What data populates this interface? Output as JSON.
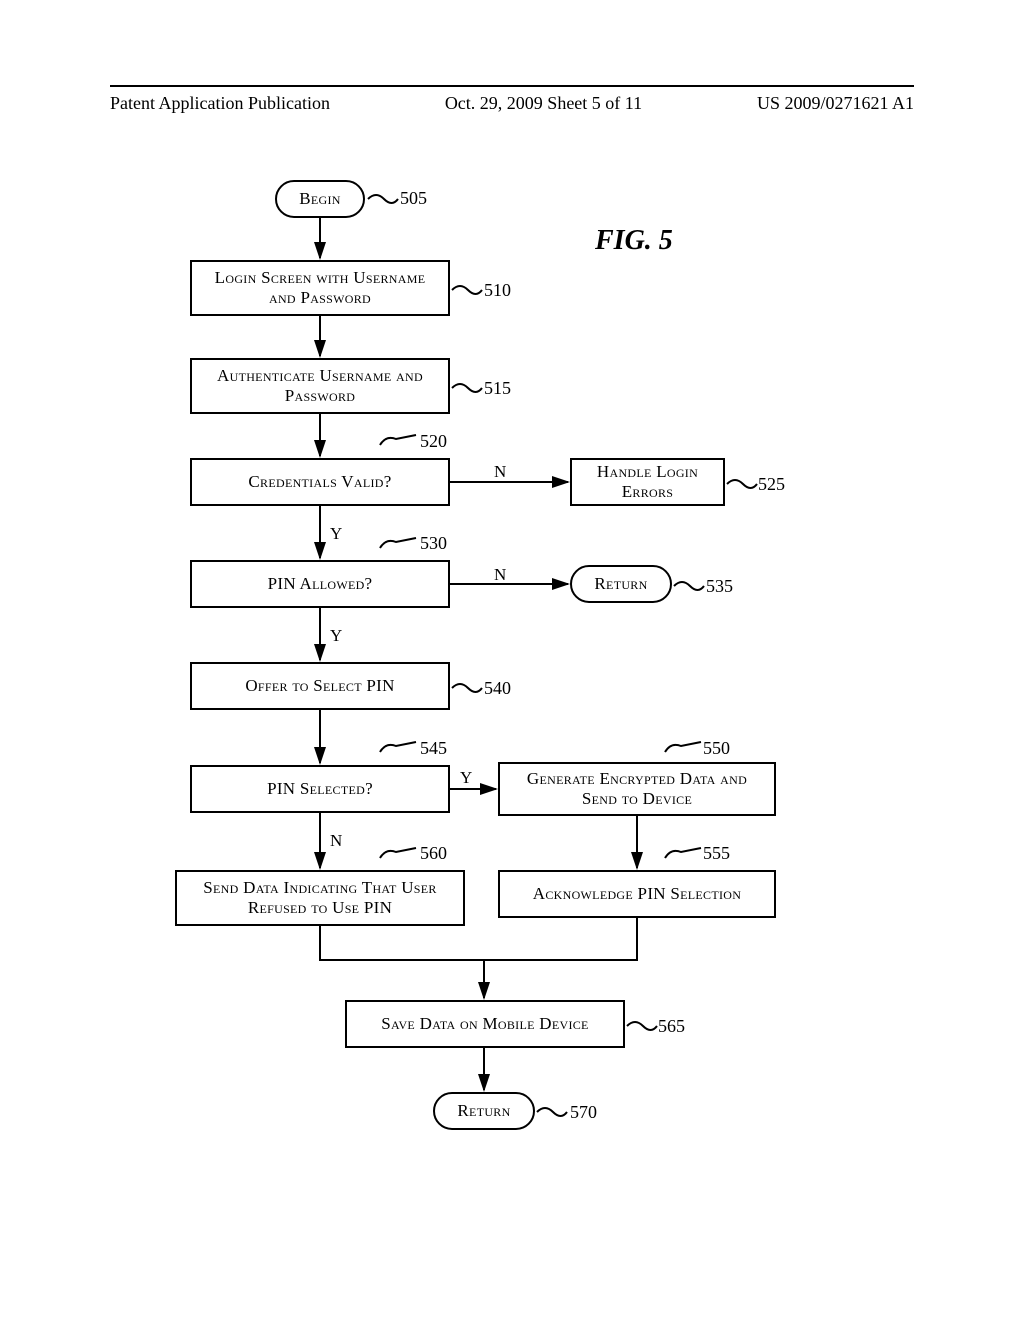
{
  "header": {
    "left": "Patent Application Publication",
    "center": "Oct. 29, 2009  Sheet 5 of 11",
    "right": "US 2009/0271621 A1"
  },
  "figure": {
    "title": "FIG. 5"
  },
  "labels": {
    "Y": "Y",
    "N": "N"
  },
  "refs": {
    "r505": "505",
    "r510": "510",
    "r515": "515",
    "r520": "520",
    "r525": "525",
    "r530": "530",
    "r535": "535",
    "r540": "540",
    "r545": "545",
    "r550": "550",
    "r555": "555",
    "r560": "560",
    "r565": "565",
    "r570": "570"
  },
  "nodes": {
    "begin": "Begin",
    "login_screen": "Login Screen with Username and Password",
    "authenticate": "Authenticate Username and Password",
    "credentials_valid": "Credentials Valid?",
    "handle_errors": "Handle Login Errors",
    "pin_allowed": "PIN Allowed?",
    "return1": "Return",
    "offer_pin": "Offer to Select PIN",
    "pin_selected": "PIN Selected?",
    "generate_encrypted": "Generate Encrypted Data and Send to Device",
    "send_refused": "Send Data Indicating That User Refused to Use PIN",
    "ack_pin": "Acknowledge PIN Selection",
    "save_data": "Save Data on Mobile Device",
    "return2": "Return"
  }
}
